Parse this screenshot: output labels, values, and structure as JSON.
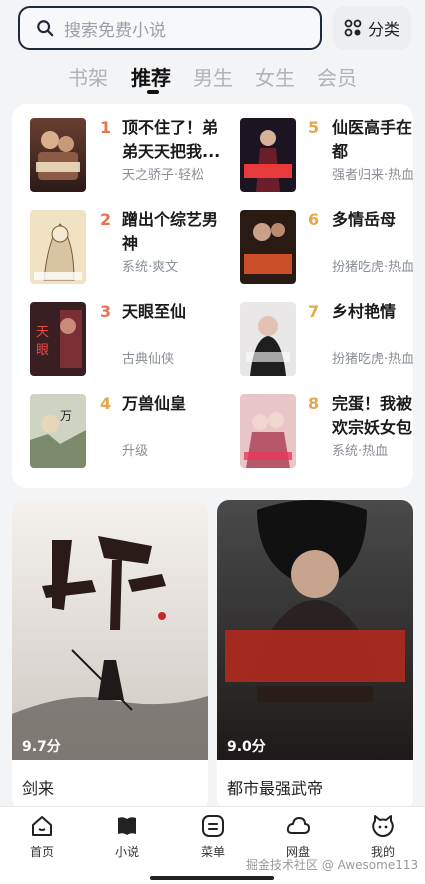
{
  "search": {
    "placeholder": "搜索免费小说"
  },
  "category_button": {
    "label": "分类"
  },
  "tabs": [
    {
      "label": "书架",
      "active": false
    },
    {
      "label": "推荐",
      "active": true
    },
    {
      "label": "男生",
      "active": false
    },
    {
      "label": "女生",
      "active": false
    },
    {
      "label": "会员",
      "active": false
    }
  ],
  "ranking": [
    {
      "rank": "1",
      "title": "顶不住了！弟弟天天把我...",
      "meta": "天之骄子·轻松"
    },
    {
      "rank": "2",
      "title": "蹭出个综艺男神",
      "meta": "系统·爽文"
    },
    {
      "rank": "3",
      "title": "天眼至仙",
      "meta": "古典仙侠"
    },
    {
      "rank": "4",
      "title": "万兽仙皇",
      "meta": "升级"
    },
    {
      "rank": "5",
      "title": "仙医高手在都",
      "meta": "强者归来·热血"
    },
    {
      "rank": "6",
      "title": "多情岳母",
      "meta": "扮猪吃虎·热血"
    },
    {
      "rank": "7",
      "title": "乡村艳情",
      "meta": "扮猪吃虎·热血"
    },
    {
      "rank": "8",
      "title": "完蛋！我被欢宗妖女包",
      "meta": "系统·热血"
    }
  ],
  "featured": [
    {
      "title": "剑来",
      "score": "9.7分"
    },
    {
      "title": "都市最强武帝",
      "score": "9.0分"
    }
  ],
  "nav": [
    {
      "label": "首页",
      "icon": "home-icon"
    },
    {
      "label": "小说",
      "icon": "book-icon"
    },
    {
      "label": "菜单",
      "icon": "menu-icon"
    },
    {
      "label": "网盘",
      "icon": "cloud-icon"
    },
    {
      "label": "我的",
      "icon": "profile-icon"
    }
  ],
  "watermark": "掘金技术社区 @ Awesome113",
  "colors": {
    "rank_top": "#e8734a",
    "rank_rest": "#e8a64a",
    "nav_active": "#111111"
  }
}
